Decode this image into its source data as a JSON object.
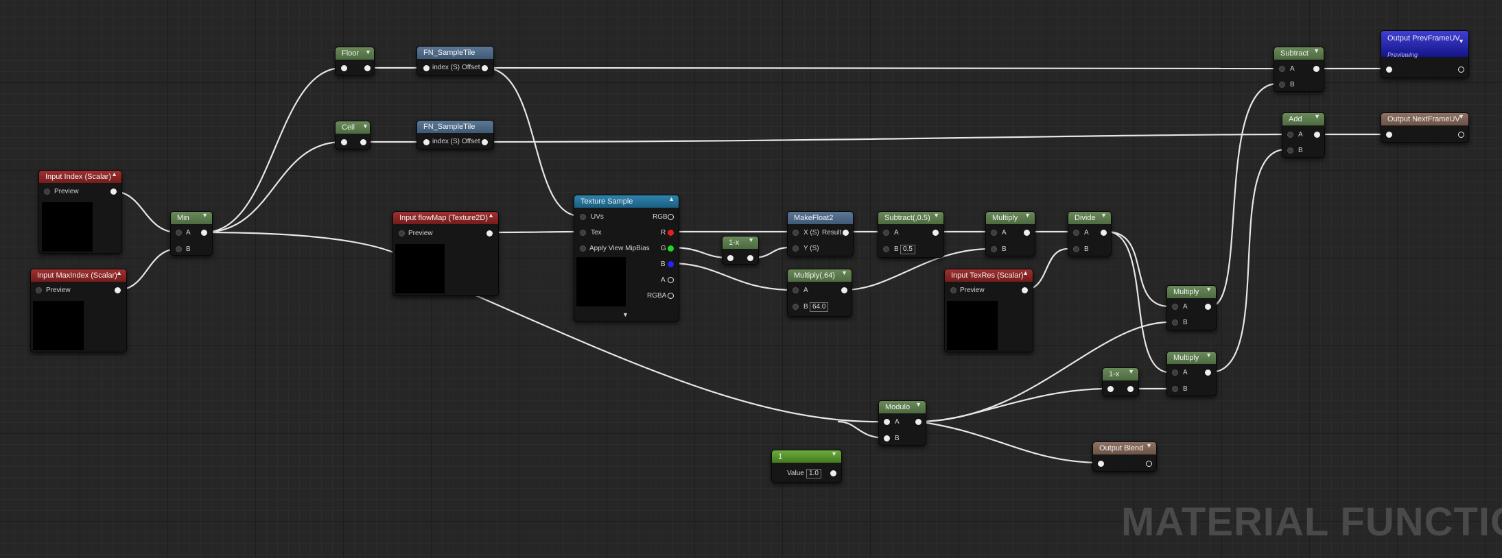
{
  "nodes": {
    "floor": {
      "title": "Floor"
    },
    "ceil": {
      "title": "Ceil"
    },
    "sample_tile_1": {
      "title": "FN_SampleTile",
      "in": "index (S)",
      "out": "Offset"
    },
    "sample_tile_2": {
      "title": "FN_SampleTile",
      "in": "index (S)",
      "out": "Offset"
    },
    "input_index": {
      "title": "Input Index (Scalar)",
      "preview": "Preview"
    },
    "input_maxindex": {
      "title": "Input MaxIndex (Scalar)",
      "preview": "Preview"
    },
    "min": {
      "title": "Min",
      "a": "A",
      "b": "B"
    },
    "flowmap": {
      "title": "Input flowMap (Texture2D)",
      "preview": "Preview"
    },
    "texture_sample": {
      "title": "Texture Sample",
      "uvs": "UVs",
      "tex": "Tex",
      "mipbias": "Apply View MipBias",
      "rgb": "RGB",
      "r": "R",
      "g": "G",
      "b": "B",
      "a": "A",
      "rgba": "RGBA"
    },
    "one_minus_1": {
      "title": "1-x"
    },
    "makefloat2": {
      "title": "MakeFloat2",
      "x": "X (S)",
      "y": "Y (S)",
      "result": "Result"
    },
    "multiply_64": {
      "title": "Multiply(,64)",
      "a": "A",
      "b": "B",
      "b_value": "64.0"
    },
    "subtract_05": {
      "title": "Subtract(,0.5)",
      "a": "A",
      "b": "B",
      "b_value": "0.5"
    },
    "multiply_1": {
      "title": "Multiply",
      "a": "A",
      "b": "B"
    },
    "input_texres": {
      "title": "Input TexRes (Scalar)",
      "preview": "Preview"
    },
    "divide": {
      "title": "Divide",
      "a": "A",
      "b": "B"
    },
    "multiply_2": {
      "title": "Multiply",
      "a": "A",
      "b": "B"
    },
    "multiply_3": {
      "title": "Multiply",
      "a": "A",
      "b": "B"
    },
    "one_minus_2": {
      "title": "1-x"
    },
    "modulo": {
      "title": "Modulo",
      "a": "A",
      "b": "B"
    },
    "constant": {
      "title": "1",
      "label": "Value",
      "value": "1.0"
    },
    "output_blend": {
      "title": "Output Blend"
    },
    "subtract": {
      "title": "Subtract",
      "a": "A",
      "b": "B"
    },
    "add": {
      "title": "Add",
      "a": "A",
      "b": "B"
    },
    "output_prev": {
      "title": "Output PrevFrameUV",
      "subtitle": "Previewing"
    },
    "output_next": {
      "title": "Output NextFrameUV"
    }
  },
  "watermark": "MATERIAL FUNCTION",
  "colors": {
    "canvas": "#262626",
    "header_green": "#5a7a4c",
    "header_blue": "#4d6986",
    "header_red": "#8a2626",
    "header_tan": "#7d6255",
    "header_texture": "#2a7aa2",
    "header_constant": "#5a9430",
    "header_output_prev": "#2c2cb8",
    "pin_r": "#e81d1d",
    "pin_g": "#22d522",
    "pin_b": "#2424ff"
  }
}
